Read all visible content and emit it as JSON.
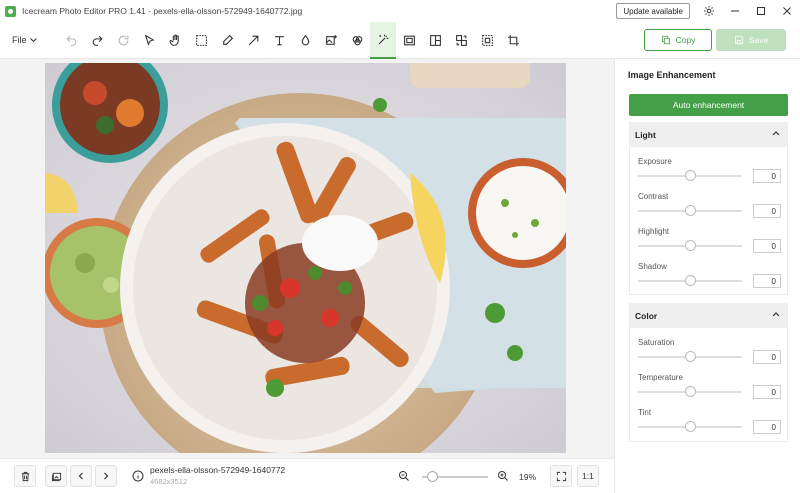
{
  "window": {
    "title": "Icecream Photo Editor PRO 1.41 - pexels-ella-olsson-572949-1640772.jpg",
    "update_label": "Update available"
  },
  "toolbar": {
    "file_label": "File",
    "copy_label": "Copy",
    "save_label": "Save",
    "accent_color": "#43a047",
    "tools": [
      "undo-icon",
      "redo-icon",
      "reset-icon",
      "pointer-icon",
      "hand-icon",
      "select-icon",
      "brush-icon",
      "arrow-icon",
      "text-icon",
      "drop-icon",
      "image-add-icon",
      "palette-icon",
      "magic-wand-icon",
      "frame-icon",
      "collage-icon",
      "swap-icon",
      "resize-icon",
      "crop-icon"
    ],
    "active_tool": "magic-wand-icon"
  },
  "panel": {
    "title": "Image Enhancement",
    "auto_label": "Auto enhancement",
    "light": {
      "label": "Light",
      "sliders": [
        {
          "label": "Exposure",
          "value": "0",
          "level": 50
        },
        {
          "label": "Contrast",
          "value": "0",
          "level": 50
        },
        {
          "label": "Highlight",
          "value": "0",
          "level": 50
        },
        {
          "label": "Shadow",
          "value": "0",
          "level": 50
        }
      ]
    },
    "color": {
      "label": "Color",
      "sliders": [
        {
          "label": "Saturation",
          "value": "0",
          "level": 50
        },
        {
          "label": "Temperature",
          "value": "0",
          "level": 50
        },
        {
          "label": "Tint",
          "value": "0",
          "level": 50
        }
      ]
    }
  },
  "bottom": {
    "file_name": "pexels-ella-olsson-572949-1640772",
    "file_dims": "4682x3512",
    "zoom": "19%",
    "zoom_level": 15,
    "one_to_one": "1:1"
  }
}
